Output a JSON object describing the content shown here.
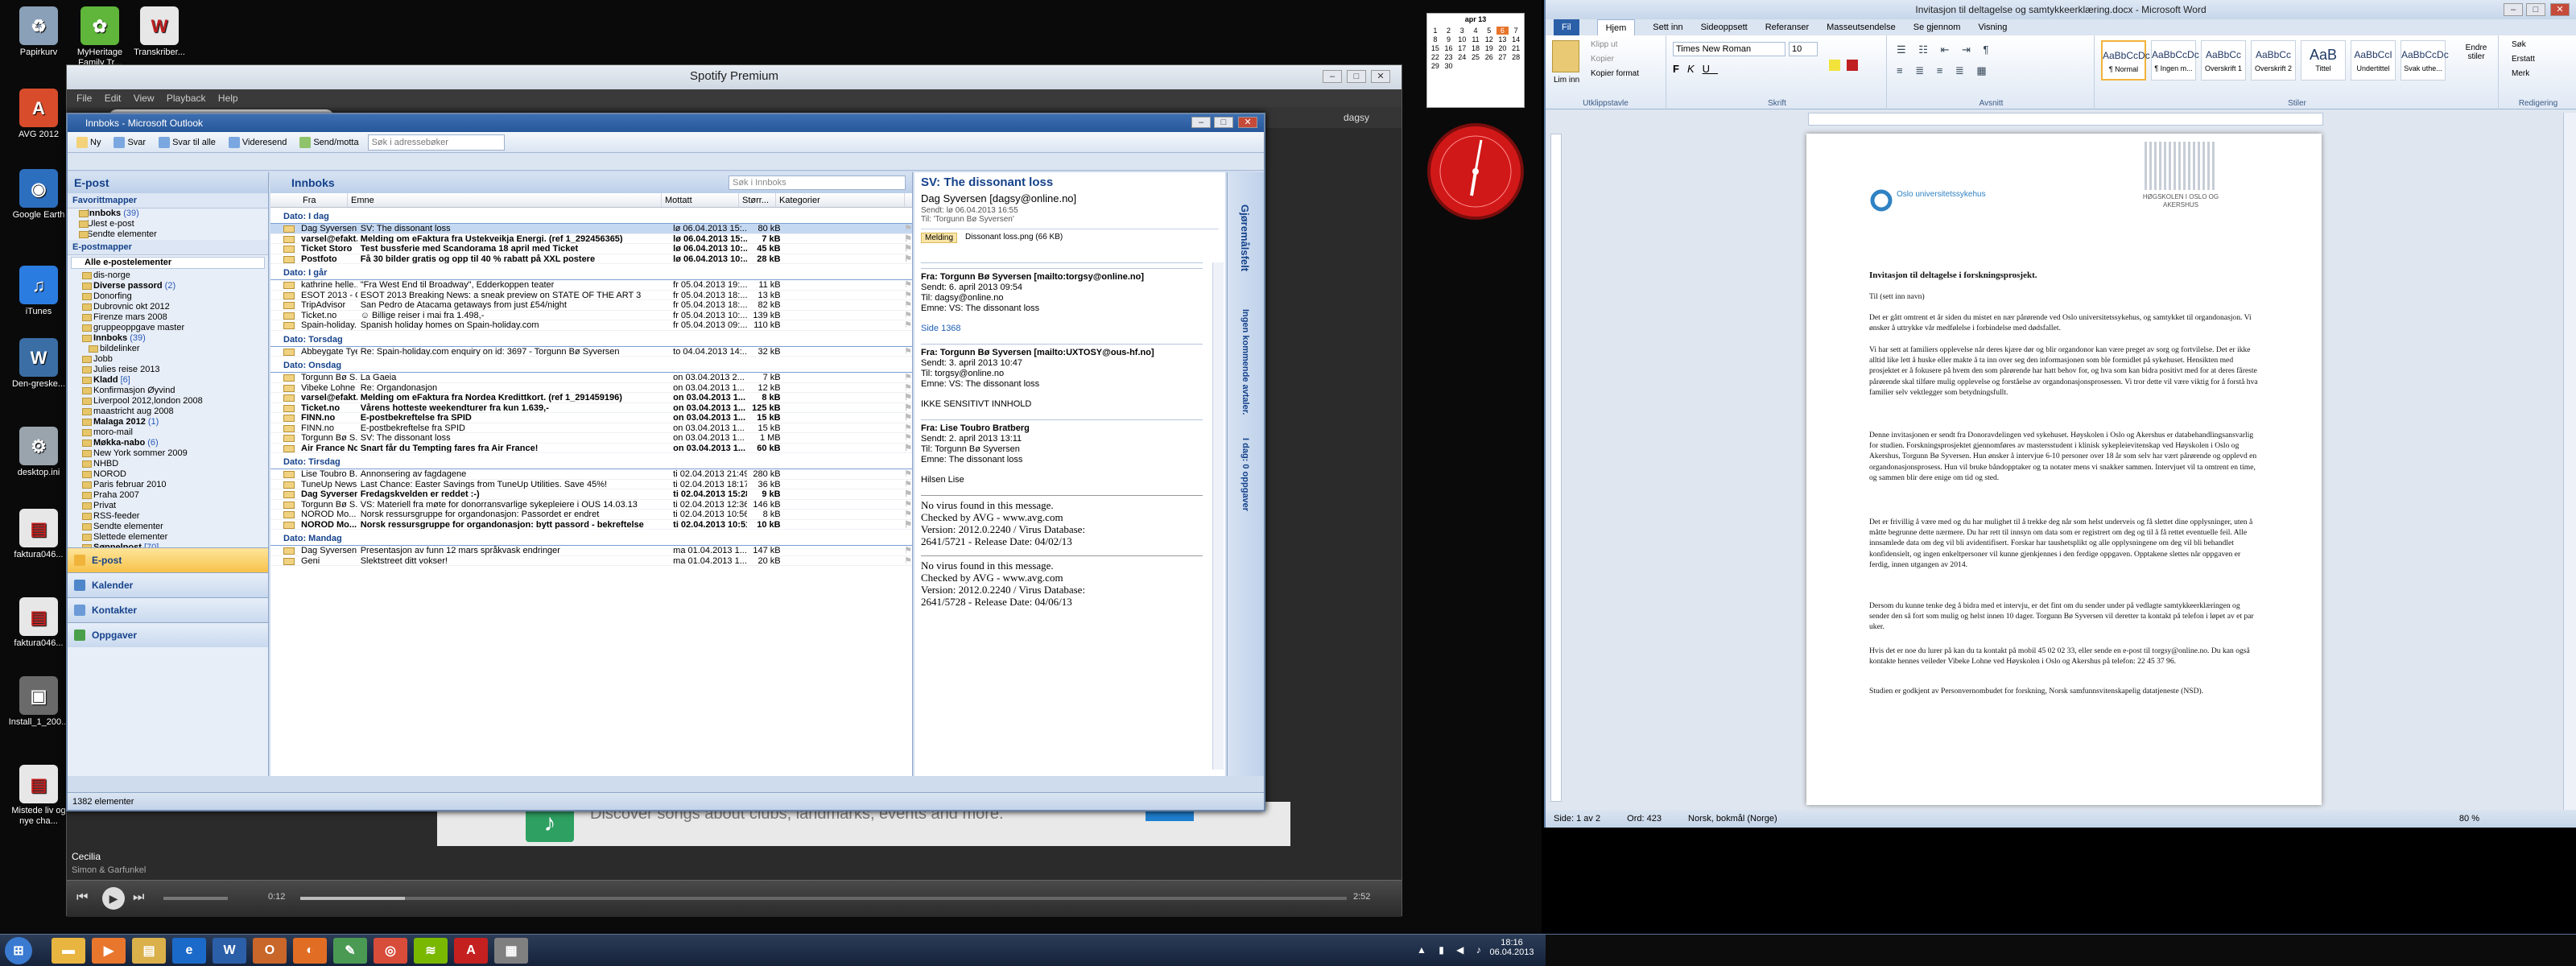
{
  "desktop": {
    "icons": [
      {
        "label": "Papirkurv",
        "color": "#8aa0b8",
        "glyph": "♻"
      },
      {
        "label": "AVG 2012",
        "color": "#d84c2b",
        "glyph": "A"
      },
      {
        "label": "Google Earth",
        "color": "#2d6fbf",
        "glyph": "◉"
      },
      {
        "label": "iTunes",
        "color": "#2b7ce0",
        "glyph": "♫"
      },
      {
        "label": "Den-greske...",
        "color": "#3b6ea5",
        "glyph": "W"
      },
      {
        "label": "desktop.ini",
        "color": "#9aa4ad",
        "glyph": "⚙"
      },
      {
        "label": "faktura046...",
        "color": "#e7e7e7",
        "glyph": "▤"
      },
      {
        "label": "faktura046...",
        "color": "#e7e7e7",
        "glyph": "▤"
      },
      {
        "label": "Install_1_200...",
        "color": "#6a6a6a",
        "glyph": "▣"
      },
      {
        "label": "Mistede liv og nye cha...",
        "color": "#e7e7e7",
        "glyph": "▤"
      },
      {
        "label": "MyHeritage Family Tr...",
        "color": "#5fb63a",
        "glyph": "✿"
      },
      {
        "label": "Transkriber...",
        "color": "#e7e7e7",
        "glyph": "W"
      }
    ]
  },
  "spotify": {
    "title": "Spotify Premium",
    "menu": [
      "File",
      "Edit",
      "View",
      "Playback",
      "Help"
    ],
    "search_placeholder": "Search",
    "user": "dagsy",
    "ad_text": "Discover songs about clubs, landmarks, events and more.",
    "now_playing": {
      "track": "Cecilia",
      "artist": "Simon & Garfunkel"
    },
    "time_elapsed": "0:12",
    "time_total": "2:52",
    "progress": 0.1
  },
  "outlook": {
    "title": "Innboks - Microsoft Outlook",
    "toolbar": [
      "Ny",
      "Svar",
      "Svar til alle",
      "Videresend",
      "Send/motta",
      "Søk i adressebøker"
    ],
    "nav_title": "E-post",
    "favorites_header": "Favorittmapper",
    "favorites": [
      {
        "name": "Innboks",
        "count": "(39)"
      },
      {
        "name": "Ulest e-post",
        "count": ""
      },
      {
        "name": "Sendte elementer",
        "count": ""
      }
    ],
    "mailboxes_header": "E-postmapper",
    "all_items": "Alle e-postelementer",
    "folders": [
      {
        "name": "dis-norge",
        "count": ""
      },
      {
        "name": "Diverse passord",
        "count": "(2)"
      },
      {
        "name": "Donorfing",
        "count": ""
      },
      {
        "name": "Dubrovnic okt 2012",
        "count": ""
      },
      {
        "name": "Firenze mars 2008",
        "count": ""
      },
      {
        "name": "gruppeoppgave master",
        "count": ""
      },
      {
        "name": "Innboks",
        "count": "(39)"
      },
      {
        "name": "bildelinker",
        "count": ""
      },
      {
        "name": "Jobb",
        "count": ""
      },
      {
        "name": "Julies reise 2013",
        "count": ""
      },
      {
        "name": "Kladd",
        "count": "[6]"
      },
      {
        "name": "Konfirmasjon Øyvind",
        "count": ""
      },
      {
        "name": "Liverpool 2012,london 2008",
        "count": ""
      },
      {
        "name": "maastricht aug 2008",
        "count": ""
      },
      {
        "name": "Malaga 2012",
        "count": "(1)"
      },
      {
        "name": "moro-mail",
        "count": ""
      },
      {
        "name": "Møkka-nabo",
        "count": "(6)"
      },
      {
        "name": "New York sommer 2009",
        "count": ""
      },
      {
        "name": "NHBD",
        "count": ""
      },
      {
        "name": "NOROD",
        "count": ""
      },
      {
        "name": "Paris februar 2010",
        "count": ""
      },
      {
        "name": "Praha 2007",
        "count": ""
      },
      {
        "name": "Privat",
        "count": ""
      },
      {
        "name": "RSS-feeder",
        "count": ""
      },
      {
        "name": "Sendte elementer",
        "count": ""
      },
      {
        "name": "Slettede elementer",
        "count": ""
      },
      {
        "name": "Søppelpost",
        "count": "[70]"
      }
    ],
    "nav_buttons": [
      "E-post",
      "Kalender",
      "Kontakter",
      "Oppgaver"
    ],
    "list_title": "Innboks",
    "search_placeholder": "Søk i Innboks",
    "columns": [
      "Fra",
      "Emne",
      "Mottatt",
      "Størr...",
      "Kategorier"
    ],
    "groups": [
      {
        "label": "Dato: I dag",
        "rows": [
          {
            "from": "Dag Syversen",
            "subject": "SV: The dissonant loss",
            "date": "lø 06.04.2013 15:...",
            "size": "80 kB",
            "unread": false,
            "sel": true
          },
          {
            "from": "varsel@efakt...",
            "subject": "Melding om eFaktura fra Ustekveikja Energi. (ref 1_292456365)",
            "date": "lø 06.04.2013 15:...",
            "size": "7 kB",
            "unread": true
          },
          {
            "from": "Ticket Storo",
            "subject": "Test bussferie med Scandorama 18 april med Ticket",
            "date": "lø 06.04.2013 10:...",
            "size": "45 kB",
            "unread": true
          },
          {
            "from": "Postfoto",
            "subject": "Få 30 bilder gratis og opp til 40 % rabatt på XXL postere",
            "date": "lø 06.04.2013 10:...",
            "size": "28 kB",
            "unread": true
          }
        ]
      },
      {
        "label": "Dato: I går",
        "rows": [
          {
            "from": "kathrine helle...",
            "subject": "\"Fra West End til Broadway\", Edderkoppen teater",
            "date": "fr 05.04.2013 19:...",
            "size": "11 kB",
            "unread": false
          },
          {
            "from": "ESOT 2013 - C...",
            "subject": "ESOT 2013 Breaking News: a sneak preview on STATE OF THE ART 3",
            "date": "fr 05.04.2013 18:...",
            "size": "13 kB",
            "unread": false
          },
          {
            "from": "TripAdvisor",
            "subject": "San Pedro de Atacama getaways from just £54/night",
            "date": "fr 05.04.2013 18:...",
            "size": "82 kB",
            "unread": false
          },
          {
            "from": "Ticket.no",
            "subject": "☺ Billige reiser i mai fra 1.498,-",
            "date": "fr 05.04.2013 10:...",
            "size": "139 kB",
            "unread": false
          },
          {
            "from": "Spain-holiday...",
            "subject": "Spanish holiday homes on Spain-holiday.com",
            "date": "fr 05.04.2013 09:...",
            "size": "110 kB",
            "unread": false
          }
        ]
      },
      {
        "label": "Dato: Torsdag",
        "rows": [
          {
            "from": "Abbeygate Tye",
            "subject": "Re: Spain-holiday.com enquiry on id: 3697 - Torgunn Bø Syversen",
            "date": "to 04.04.2013 14:...",
            "size": "32 kB",
            "unread": false
          }
        ]
      },
      {
        "label": "Dato: Onsdag",
        "rows": [
          {
            "from": "Torgunn Bø S...",
            "subject": "La Gaeia",
            "date": "on 03.04.2013 2...",
            "size": "7 kB",
            "unread": false
          },
          {
            "from": "Vibeke Lohne",
            "subject": "Re: Organdonasjon",
            "date": "on 03.04.2013 1...",
            "size": "12 kB",
            "unread": false
          },
          {
            "from": "varsel@efakt...",
            "subject": "Melding om eFaktura fra Nordea Kredittkort. (ref 1_291459196)",
            "date": "on 03.04.2013 1...",
            "size": "8 kB",
            "unread": true
          },
          {
            "from": "Ticket.no",
            "subject": "Vårens hotteste weekendturer fra kun 1.639,-",
            "date": "on 03.04.2013 1...",
            "size": "125 kB",
            "unread": true
          },
          {
            "from": "FINN.no",
            "subject": "E-postbekreftelse fra SPID",
            "date": "on 03.04.2013 1...",
            "size": "15 kB",
            "unread": true
          },
          {
            "from": "FINN.no",
            "subject": "E-postbekreftelse fra SPID",
            "date": "on 03.04.2013 1...",
            "size": "15 kB",
            "unread": false
          },
          {
            "from": "Torgunn Bø S...",
            "subject": "SV: The dissonant loss",
            "date": "on 03.04.2013 1...",
            "size": "1 MB",
            "unread": false
          },
          {
            "from": "Air France No...",
            "subject": "Snart får du Tempting fares fra Air France!",
            "date": "on 03.04.2013 1...",
            "size": "60 kB",
            "unread": true
          }
        ]
      },
      {
        "label": "Dato: Tirsdag",
        "rows": [
          {
            "from": "Lise Toubro B...",
            "subject": "Annonsering av fagdagene",
            "date": "ti 02.04.2013 21:49",
            "size": "280 kB",
            "unread": false
          },
          {
            "from": "TuneUp News...",
            "subject": "Last Chance: Easter Savings from TuneUp Utilities. Save 45%!",
            "date": "ti 02.04.2013 18:17",
            "size": "36 kB",
            "unread": false
          },
          {
            "from": "Dag Syversen",
            "subject": "Fredagskvelden er reddet :-)",
            "date": "ti 02.04.2013 15:28",
            "size": "9 kB",
            "unread": true
          },
          {
            "from": "Torgunn Bø S...",
            "subject": "VS: Materiell fra møte for donorransvarlige sykepleiere i OUS 14.03.13",
            "date": "ti 02.04.2013 12:36",
            "size": "146 kB",
            "unread": false
          },
          {
            "from": "NOROD Mo...",
            "subject": "Norsk ressursgruppe for organdonasjon: Passordet er endret",
            "date": "ti 02.04.2013 10:56",
            "size": "8 kB",
            "unread": false
          },
          {
            "from": "NOROD Mo...",
            "subject": "Norsk ressursgruppe for organdonasjon: bytt passord - bekreftelse",
            "date": "ti 02.04.2013 10:51",
            "size": "10 kB",
            "unread": true
          }
        ]
      },
      {
        "label": "Dato: Mandag",
        "rows": [
          {
            "from": "Dag Syversen",
            "subject": "Presentasjon av funn 12 mars språkvask endringer",
            "date": "ma 01.04.2013 1...",
            "size": "147 kB",
            "unread": false
          },
          {
            "from": "Geni",
            "subject": "Slektstreet ditt vokser!",
            "date": "ma 01.04.2013 1...",
            "size": "20 kB",
            "unread": false
          }
        ]
      }
    ],
    "reading": {
      "subject": "SV: The dissonant loss",
      "from": "Dag Syversen [dagsy@online.no]",
      "to_label": "Til:",
      "to": "'Torgunn Bø Syversen'",
      "sent_label": "Sendt:",
      "sent": "lø 06.04.2013 16:55",
      "tab_message": "Melding",
      "attachment": "Dissonant loss.png (66 KB)",
      "blocks": [
        [
          "Fra: Torgunn Bø Syversen [mailto:torgsy@online.no]",
          "Sendt: 6. april 2013 09:54",
          "Til: dagsy@online.no",
          "Emne: VS: The dissonant loss"
        ],
        [
          "Side 1368"
        ],
        [
          "Fra: Torgunn Bø Syversen [mailto:UXTOSY@ous-hf.no]",
          "Sendt: 3. april 2013 10:47",
          "Til: torgsy@online.no",
          "Emne: VS: The dissonant loss"
        ],
        [
          "IKKE SENSITIVT INNHOLD"
        ],
        [
          "Fra: Lise Toubro Bratberg",
          "Sendt: 2. april 2013 13:11",
          "Til: Torgunn Bø Syversen",
          "Emne: The dissonant loss"
        ],
        [
          "Hilsen Lise"
        ]
      ],
      "avg1": [
        "No virus found in this message.",
        "Checked by AVG - www.avg.com",
        "Version: 2012.0.2240 / Virus Database:",
        "2641/5721 - Release Date: 04/02/13"
      ],
      "avg2": [
        "No virus found in this message.",
        "Checked by AVG - www.avg.com",
        "Version: 2012.0.2240 / Virus Database:",
        "2641/5728 - Release Date: 04/06/13"
      ]
    },
    "todo_labels": [
      "Gjøremålsfelt",
      "Ingen kommende avtaler.",
      "I dag: 0 oppgaver"
    ],
    "status": "1382 elementer"
  },
  "calendar": {
    "month": "apr 13",
    "days": [
      "1",
      "2",
      "3",
      "4",
      "5",
      "6",
      "7",
      "8",
      "9",
      "10",
      "11",
      "12",
      "13",
      "14",
      "15",
      "16",
      "17",
      "18",
      "19",
      "20",
      "21",
      "22",
      "23",
      "24",
      "25",
      "26",
      "27",
      "28",
      "29",
      "30"
    ]
  },
  "word": {
    "title": "Invitasjon til deltagelse og samtykkeerklæring.docx - Microsoft Word",
    "tabs": [
      "Fil",
      "Hjem",
      "Sett inn",
      "Sideoppsett",
      "Referanser",
      "Masseutsendelse",
      "Se gjennom",
      "Visning"
    ],
    "font": "Times New Roman",
    "size": "10",
    "clipboard": [
      "Lim inn",
      "Klipp ut",
      "Kopier",
      "Kopier format"
    ],
    "groups": [
      "Utklippstavle",
      "Skrift",
      "Avsnitt",
      "Stiler",
      "Redigering"
    ],
    "styles": [
      {
        "preview": "AaBbCcDc",
        "name": "¶ Normal"
      },
      {
        "preview": "AaBbCcDc",
        "name": "¶ Ingen m..."
      },
      {
        "preview": "AaBbCc",
        "name": "Overskrift 1"
      },
      {
        "preview": "AaBbCc",
        "name": "Overskrift 2"
      },
      {
        "preview": "AaB",
        "name": "Tittel"
      },
      {
        "preview": "AaBbCcI",
        "name": "Undertittel"
      },
      {
        "preview": "AaBbCcDc",
        "name": "Svak uthe..."
      }
    ],
    "editing": [
      "Søk",
      "Erstatt",
      "Merk"
    ],
    "change_styles": "Endre stiler",
    "logo_left": "Oslo universitetssykehus",
    "logo_right": "HØGSKOLEN I OSLO OG AKERSHUS",
    "doc_title": "Invitasjon til deltagelse i forskningsprosjekt.",
    "salutation": "Til (sett inn navn)",
    "paragraphs": [
      "Det er gått omtrent et år siden du mistet en nær pårørende ved Oslo universitetssykehus, og samtykket til organdonasjon. Vi ønsker å uttrykke vår medfølelse i forbindelse med dødsfallet.",
      "Vi har sett at familiers opplevelse når deres kjære dør og blir organdonor kan være preget av sorg og fortvilelse. Det er ikke alltid like lett å huske eller makte å ta inn over seg den informasjonen som ble formidlet på sykehuset. Hensikten med prosjektet er å fokusere på hvem den som pårørende har hatt behov for, og hva som kan bidra positivt med for at deres fåreste pårørende skal tilføre mulig opplevelse og forståelse av organdonasjonsprosessen. Vi tror dette vil være viktig for å forstå hva familier selv vektlegger som betydningsfullt.",
      "Denne invitasjonen er sendt fra Donoravdelingen ved sykehuset. Høyskolen i Oslo og Akershus er databehandlingsansvarlig for studien. Forskningsprosjektet gjennomføres av mastersstudent i klinisk sykepleievitenskap ved Høyskolen i Oslo og Akershus, Torgunn Bø Syversen. Hun ønsker å intervjue 6-10 personer over 18 år som selv har vært pårørende og opplevd en organdonasjonsprosess. Hun vil bruke båndopptaker og ta notater mens vi snakker sammen. Intervjuet vil ta omtrent en time, og sammen blir dere enige om tid og sted.",
      "Det er frivillig å være med og du har mulighet til å trekke deg når som helst underveis og få slettet dine opplysninger, uten å måtte begrunne dette nærmere. Du har rett til innsyn om data som er registrert om deg og til å få rettet eventuelle feil. Alle innsamlede data om deg vil bli avidentifisert. Forskar har taushetsplikt og alle opplysningene om deg vil bli behandlet konfidensielt, og ingen enkeltpersoner vil kunne gjenkjennes i den ferdige oppgaven. Opptakene slettes når oppgaven er ferdig, innen utgangen av 2014.",
      "Dersom du kunne tenke deg å bidra med et intervju, er det fint om du sender under på vedlagte samtykkeerklæringen og sender den så fort som mulig og helst innen 10 dager. Torgunn Bø Syversen vil deretter ta kontakt på telefon i løpet av et par uker.",
      "Hvis det er noe du lurer på kan du ta kontakt på mobil 45 02 02 33, eller sende en e-post til torgsy@online.no. Du kan også kontakte hennes veileder Vibeke Lohne ved Høyskolen i Oslo og Akershus på telefon: 22 45 37 96.",
      "Studien er godkjent av Personvernombudet for forskning, Norsk samfunnsvitenskapelig datatjeneste (NSD)."
    ],
    "status_page": "Side: 1 av 2",
    "status_words": "Ord: 423",
    "status_lang": "Norsk, bokmål (Norge)",
    "zoom": "80 %"
  },
  "taskbar": {
    "time": "18:16",
    "date": "06.04.2013",
    "apps": [
      {
        "name": "start",
        "color": "#3a7ad1",
        "glyph": "⊞"
      },
      {
        "name": "explorer",
        "color": "#e7b540",
        "glyph": "▬"
      },
      {
        "name": "media",
        "color": "#e8762d",
        "glyph": "▶"
      },
      {
        "name": "folders",
        "color": "#d9b04a",
        "glyph": "▤"
      },
      {
        "name": "ie",
        "color": "#1b6ac9",
        "glyph": "e"
      },
      {
        "name": "word",
        "color": "#2b5fa8",
        "glyph": "W"
      },
      {
        "name": "outlook",
        "color": "#c9662a",
        "glyph": "O"
      },
      {
        "name": "firefox",
        "color": "#e16d24",
        "glyph": "◐"
      },
      {
        "name": "paint",
        "color": "#4a9a54",
        "glyph": "✎"
      },
      {
        "name": "chrome",
        "color": "#d84c3a",
        "glyph": "◎"
      },
      {
        "name": "spotify",
        "color": "#7ab800",
        "glyph": "≋"
      },
      {
        "name": "acrobat",
        "color": "#c42020",
        "glyph": "A"
      },
      {
        "name": "misc",
        "color": "#808080",
        "glyph": "▦"
      }
    ]
  }
}
